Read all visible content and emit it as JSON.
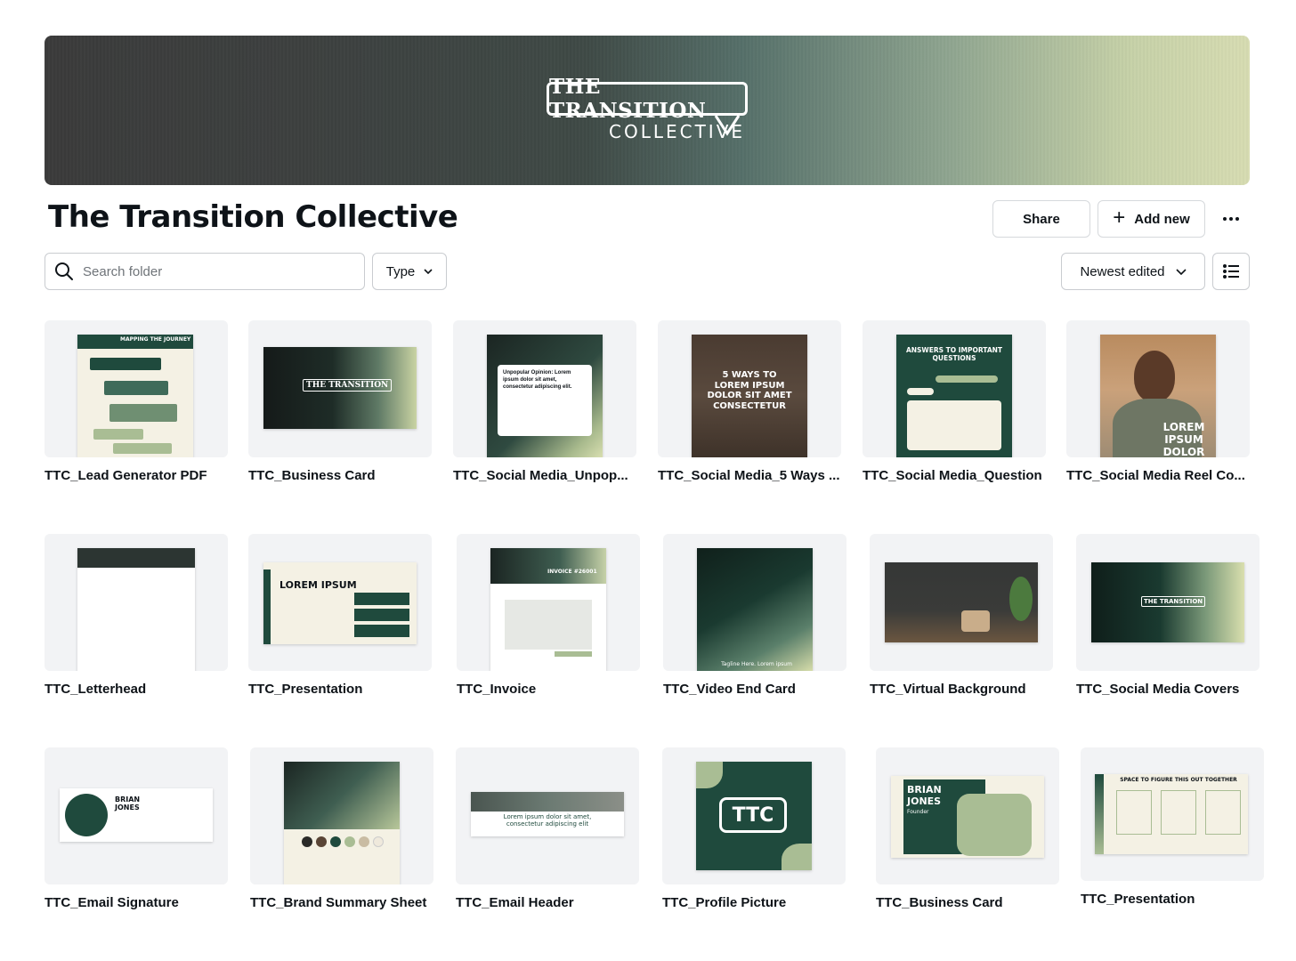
{
  "banner": {
    "logo_main": "THE TRANSITION",
    "logo_sub": "COLLECTIVE"
  },
  "header": {
    "title": "The Transition Collective",
    "share_label": "Share",
    "add_new_label": "Add new",
    "more_icon": "more-horizontal-icon"
  },
  "toolbar": {
    "search_placeholder": "Search folder",
    "type_label": "Type",
    "sort_label": "Newest edited",
    "view_icon": "list-view-icon"
  },
  "colors": {
    "accent_dark_green": "#1f4a3d",
    "sage": "#a9bd94",
    "cream": "#f4f1e4"
  },
  "files": [
    {
      "name": "TTC_Lead Generator PDF"
    },
    {
      "name": "TTC_Business Card"
    },
    {
      "name": "TTC_Social Media_Unpop..."
    },
    {
      "name": "TTC_Social Media_5 Ways ..."
    },
    {
      "name": "TTC_Social Media_Question"
    },
    {
      "name": "TTC_Social Media Reel Co..."
    },
    {
      "name": "TTC_Letterhead"
    },
    {
      "name": "TTC_Presentation"
    },
    {
      "name": "TTC_Invoice"
    },
    {
      "name": "TTC_Video End Card"
    },
    {
      "name": "TTC_Virtual Background"
    },
    {
      "name": "TTC_Social Media Covers"
    },
    {
      "name": "TTC_Email Signature"
    },
    {
      "name": "TTC_Brand Summary Sheet"
    },
    {
      "name": "TTC_Email Header"
    },
    {
      "name": "TTC_Profile Picture"
    },
    {
      "name": "TTC_Business Card"
    },
    {
      "name": "TTC_Presentation"
    }
  ],
  "previews": {
    "lead_title": "MAPPING THE JOURNEY",
    "card_logo": "THE TRANSITION",
    "unpop_text": "Unpopular Opinion: Lorem ipsum dolor sit amet, consectetur adipiscing elit.",
    "ways_text": "5 WAYS TO LOREM IPSUM DOLOR SIT AMET CONSECTETUR",
    "question_title": "ANSWERS TO IMPORTANT QUESTIONS",
    "reel_text": "LOREM IPSUM DOLOR SIT",
    "pres_title": "LOREM IPSUM",
    "invoice_title": "INVOICE #26001",
    "endcard_tagline": "Tagline Here. Lorem ipsum",
    "sig_name": "BRIAN JONES",
    "email_header_text": "Lorem ipsum dolor sit amet, consectetur adipiscing elit",
    "profile_text": "TTC",
    "bc2_name": "BRIAN JONES",
    "bc2_role": "Founder",
    "pres2_title": "SPACE TO FIGURE THIS OUT TOGETHER"
  }
}
